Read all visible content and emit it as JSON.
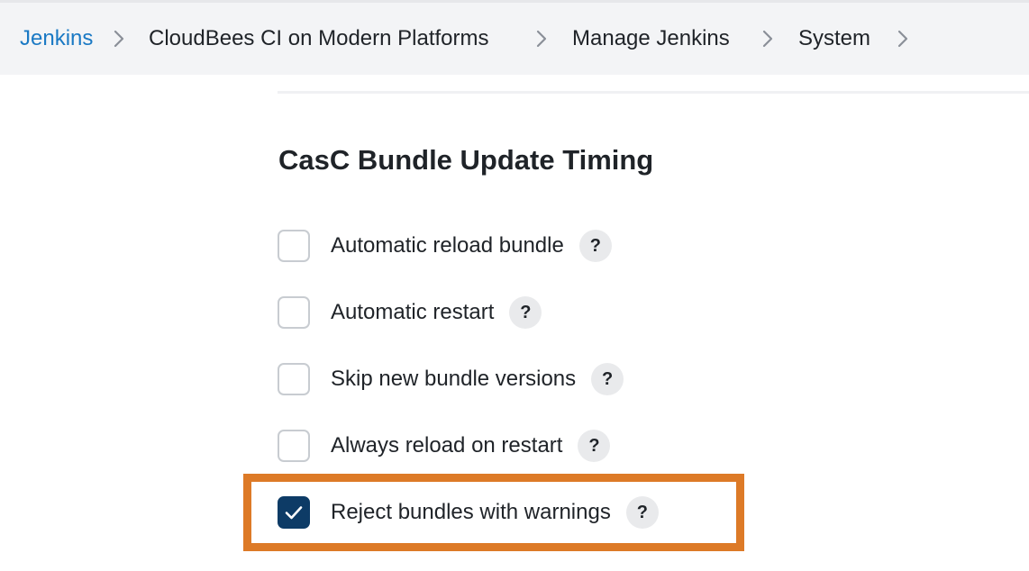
{
  "breadcrumb": {
    "items": [
      {
        "label": "Jenkins"
      },
      {
        "label": "CloudBees CI on Modern Platforms"
      },
      {
        "label": "Manage Jenkins"
      },
      {
        "label": "System"
      }
    ]
  },
  "section": {
    "title": "CasC Bundle Update Timing"
  },
  "options": [
    {
      "label": "Automatic reload bundle",
      "checked": false,
      "help": "?"
    },
    {
      "label": "Automatic restart",
      "checked": false,
      "help": "?"
    },
    {
      "label": "Skip new bundle versions",
      "checked": false,
      "help": "?"
    },
    {
      "label": "Always reload on restart",
      "checked": false,
      "help": "?"
    },
    {
      "label": "Reject bundles with warnings",
      "checked": true,
      "help": "?"
    }
  ],
  "colors": {
    "link": "#1a79c4",
    "checked_fill": "#0d3b66",
    "highlight_border": "#dd7a27",
    "breadcrumb_bg": "#f3f4f6"
  }
}
